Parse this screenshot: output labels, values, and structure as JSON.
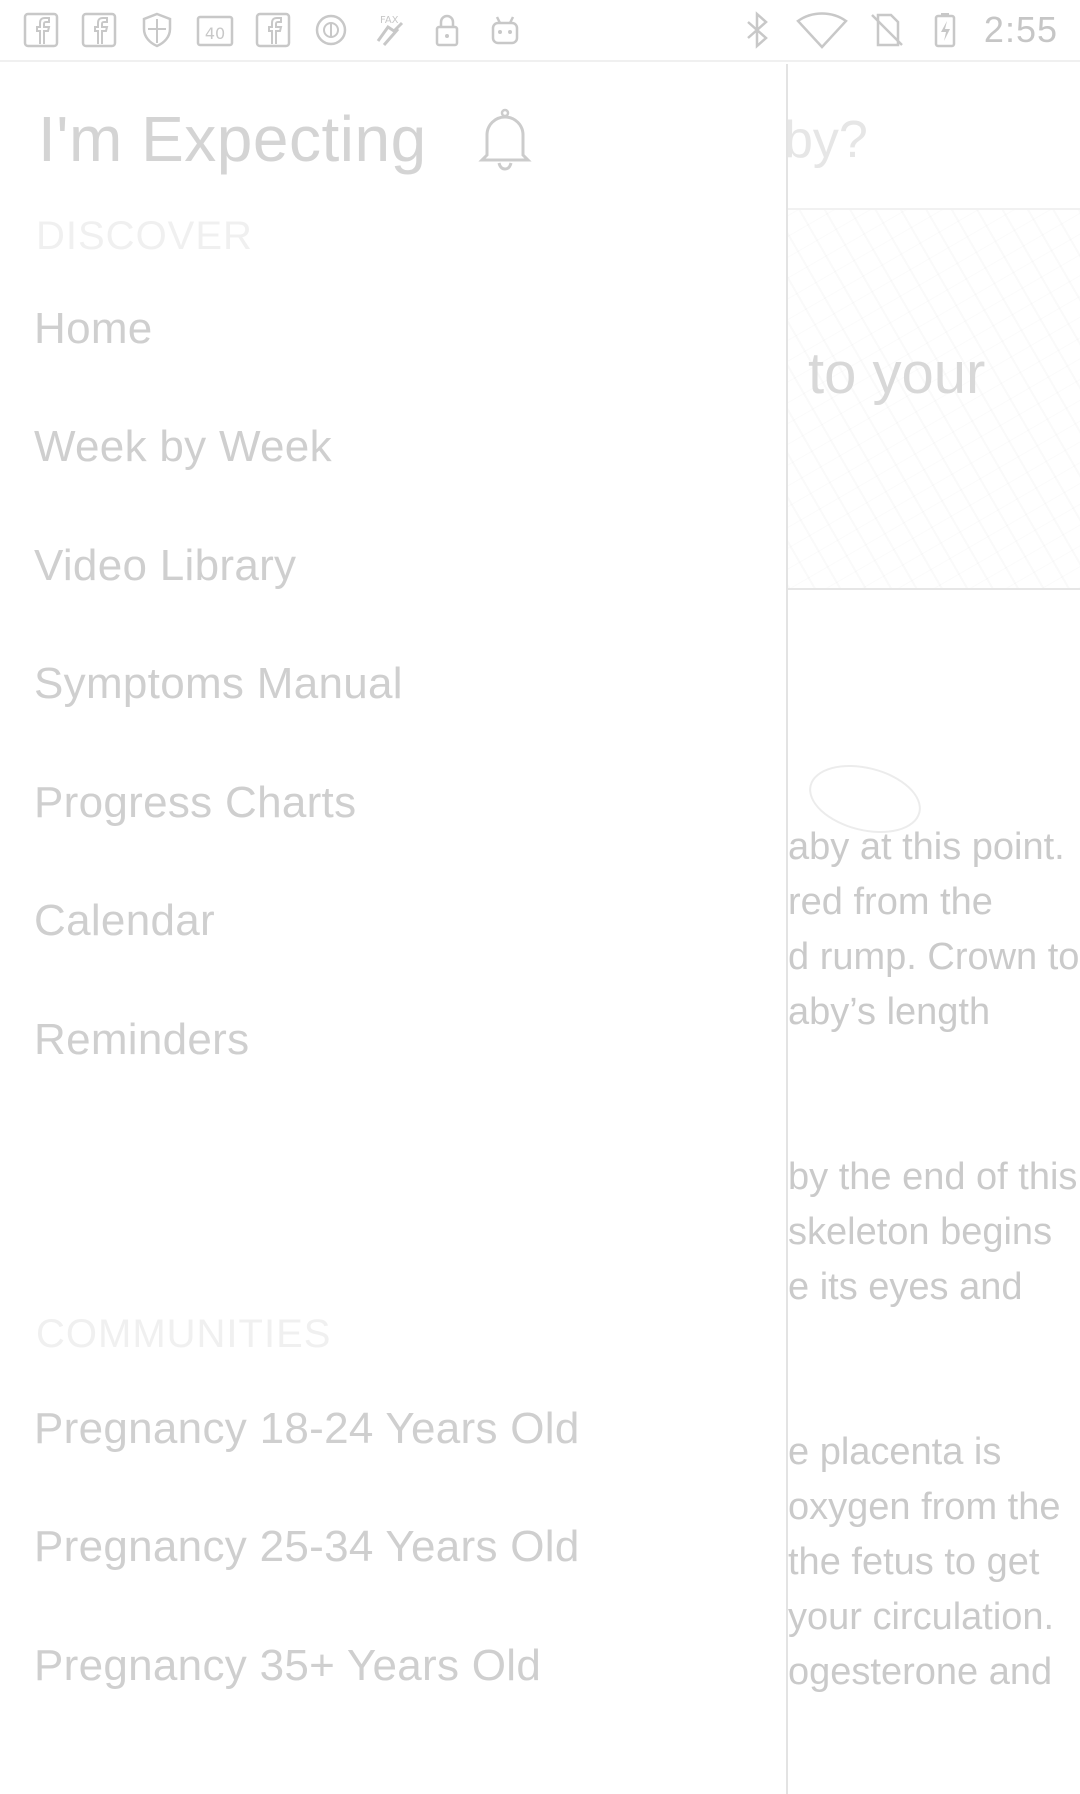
{
  "status_bar": {
    "left_icons": [
      "facebook-icon",
      "facebook-icon",
      "shield-icon",
      "calendar-40-icon",
      "facebook-icon",
      "target-icon",
      "fax-icon",
      "lock-icon",
      "android-icon"
    ],
    "calendar_badge": "40",
    "fax_label": "FAX",
    "right_icons": [
      "bluetooth-icon",
      "wifi-icon",
      "no-sim-icon",
      "battery-charging-icon"
    ],
    "time": "2:55"
  },
  "drawer": {
    "title": "I'm Expecting",
    "discover_label": "DISCOVER",
    "discover_items": [
      {
        "label": "Home"
      },
      {
        "label": "Week by Week"
      },
      {
        "label": "Video Library"
      },
      {
        "label": "Symptoms Manual"
      },
      {
        "label": "Progress Charts"
      },
      {
        "label": "Calendar"
      },
      {
        "label": "Reminders"
      }
    ],
    "communities_label": "COMMUNITIES",
    "community_items": [
      {
        "label": "Pregnancy 18-24 Years Old"
      },
      {
        "label": "Pregnancy 25-34 Years Old"
      },
      {
        "label": "Pregnancy 35+ Years Old"
      }
    ]
  },
  "background": {
    "header_title": "by?",
    "hero_text": "to your",
    "paragraph1": [
      "aby at this point.",
      "red from the",
      "d rump. Crown to",
      "aby’s length"
    ],
    "paragraph2": [
      "by the end of this",
      "skeleton begins",
      "e its eyes and"
    ],
    "paragraph3": [
      "e placenta is",
      "oxygen from the",
      "the fetus to get",
      "your circulation.",
      "ogesterone and"
    ]
  },
  "colors": {
    "text_light": "#cfcfcf",
    "divider": "#e3e3e3",
    "background": "#ffffff"
  }
}
